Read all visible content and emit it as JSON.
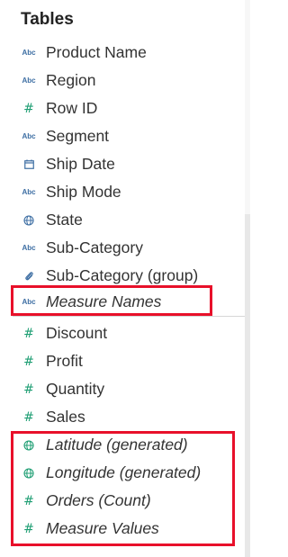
{
  "panel": {
    "title": "Tables"
  },
  "fields": [
    {
      "id": "product-name",
      "label": "Product Name",
      "icon": "abc-string-icon",
      "icon_text": "Abc",
      "italic": false
    },
    {
      "id": "region",
      "label": "Region",
      "icon": "abc-string-icon",
      "icon_text": "Abc",
      "italic": false
    },
    {
      "id": "row-id",
      "label": "Row ID",
      "icon": "number-hash-icon",
      "icon_text": "#",
      "italic": false
    },
    {
      "id": "segment",
      "label": "Segment",
      "icon": "abc-string-icon",
      "icon_text": "Abc",
      "italic": false
    },
    {
      "id": "ship-date",
      "label": "Ship Date",
      "icon": "calendar-icon",
      "icon_text": "",
      "italic": false
    },
    {
      "id": "ship-mode",
      "label": "Ship Mode",
      "icon": "abc-string-icon",
      "icon_text": "Abc",
      "italic": false
    },
    {
      "id": "state",
      "label": "State",
      "icon": "globe-icon",
      "icon_text": "",
      "italic": false
    },
    {
      "id": "sub-category",
      "label": "Sub-Category",
      "icon": "abc-string-icon",
      "icon_text": "Abc",
      "italic": false
    },
    {
      "id": "sub-category-group",
      "label": "Sub-Category (group)",
      "icon": "paperclip-group-icon",
      "icon_text": "",
      "italic": false
    },
    {
      "id": "measure-names",
      "label": "Measure Names",
      "icon": "abc-string-icon",
      "icon_text": "Abc",
      "italic": true
    },
    {
      "id": "discount",
      "label": "Discount",
      "icon": "number-hash-icon",
      "icon_text": "#",
      "italic": false
    },
    {
      "id": "profit",
      "label": "Profit",
      "icon": "number-hash-icon",
      "icon_text": "#",
      "italic": false
    },
    {
      "id": "quantity",
      "label": "Quantity",
      "icon": "number-hash-icon",
      "icon_text": "#",
      "italic": false
    },
    {
      "id": "sales",
      "label": "Sales",
      "icon": "number-hash-icon",
      "icon_text": "#",
      "italic": false
    },
    {
      "id": "latitude-generated",
      "label": "Latitude (generated)",
      "icon": "globe-icon",
      "icon_text": "",
      "italic": true
    },
    {
      "id": "longitude-generated",
      "label": "Longitude (generated)",
      "icon": "globe-icon",
      "icon_text": "",
      "italic": true
    },
    {
      "id": "orders-count",
      "label": "Orders (Count)",
      "icon": "number-hash-icon",
      "icon_text": "#",
      "italic": true
    },
    {
      "id": "measure-values",
      "label": "Measure Values",
      "icon": "number-hash-icon",
      "icon_text": "#",
      "italic": true
    }
  ],
  "colors": {
    "dimension_icon": "#3d6ea3",
    "measure_icon": "#1e9e73",
    "highlight_border": "#e8102a",
    "divider": "#d6d6d6"
  }
}
